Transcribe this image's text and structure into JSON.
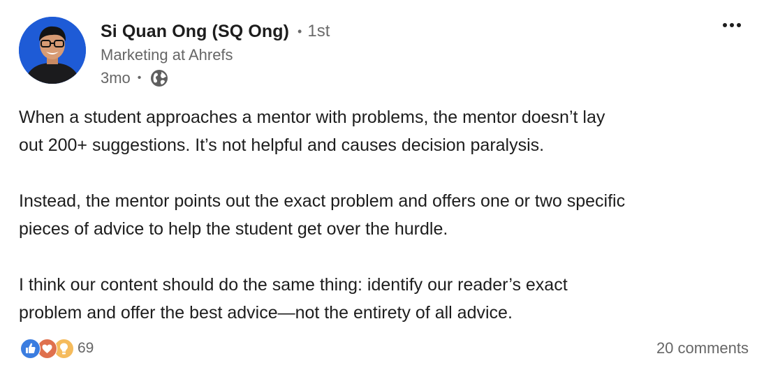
{
  "author": {
    "name": "Si Quan Ong (SQ Ong)",
    "separator": "•",
    "degree": "1st",
    "headline": "Marketing at Ahrefs"
  },
  "meta": {
    "time": "3mo",
    "separator": "•",
    "visibility_icon": "globe-icon"
  },
  "menu": {
    "icon": "more-horizontal-icon",
    "label": "•••"
  },
  "body": {
    "paragraphs": [
      {
        "lines": [
          "When a student approaches a mentor with problems, the mentor doesn’t lay",
          "out 200+ suggestions. It’s not helpful and causes decision paralysis."
        ]
      },
      {
        "lines": [
          "Instead, the mentor points out the exact problem and offers one or two specific",
          "pieces of advice to help the student get over the hurdle."
        ]
      },
      {
        "lines": [
          "I think our content should do the same thing: identify our reader’s exact",
          "problem and offer the best advice—not the entirety of all advice."
        ]
      }
    ]
  },
  "footer": {
    "reaction_icons": [
      "like-icon",
      "love-icon",
      "insightful-icon"
    ],
    "reaction_count": "69",
    "comments": "20 comments"
  },
  "colors": {
    "avatar_bg": "#1e5bd6",
    "like": "#3b7de0",
    "love": "#df704d",
    "insightful": "#f5bb5c",
    "secondary_text": "#666666"
  }
}
